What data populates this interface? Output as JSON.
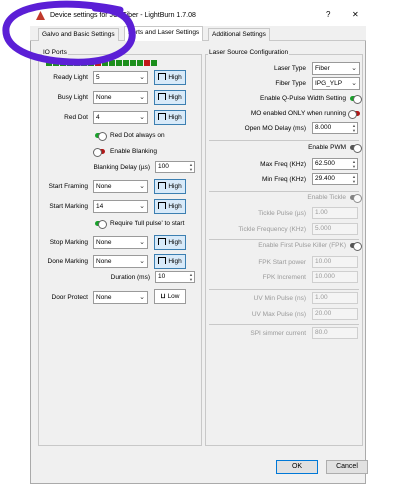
{
  "window": {
    "title": "Device settings for JCZFiber - LightBurn 1.7.08",
    "help_glyph": "?",
    "close_glyph": "✕"
  },
  "tabs": [
    {
      "label": "Galvo and Basic Settings"
    },
    {
      "label": "Ports and Laser Settings"
    },
    {
      "label": "Additional Settings"
    }
  ],
  "io_ports": {
    "group_title": "IO Ports",
    "pins": [
      "on",
      "on",
      "on",
      "on",
      "on",
      "on",
      "on",
      "off",
      "on",
      "on",
      "on",
      "on",
      "on",
      "on",
      "off",
      "on"
    ],
    "ready_light": {
      "label": "Ready Light",
      "value": "5",
      "button": "High"
    },
    "busy_light": {
      "label": "Busy Light",
      "value": "None",
      "button": "High"
    },
    "red_dot": {
      "label": "Red Dot",
      "value": "4",
      "button": "High"
    },
    "red_dot_always_on": {
      "label": "Red Dot always on",
      "checked": true
    },
    "enable_blanking": {
      "label": "Enable Blanking",
      "checked": false
    },
    "blanking_delay": {
      "label": "Blanking Delay (µs)",
      "value": "100"
    },
    "start_framing": {
      "label": "Start Framing",
      "value": "None",
      "button": "High"
    },
    "start_marking": {
      "label": "Start Marking",
      "value": "14",
      "button": "High"
    },
    "require_full_pulse": {
      "label": "Require 'full pulse' to start",
      "checked": true
    },
    "stop_marking": {
      "label": "Stop Marking",
      "value": "None",
      "button": "High"
    },
    "done_marking": {
      "label": "Done Marking",
      "value": "None",
      "button": "High"
    },
    "duration": {
      "label": "Duration (ms)",
      "value": "10"
    },
    "door_protect": {
      "label": "Door Protect",
      "value": "None",
      "button": "Low"
    }
  },
  "laser_source": {
    "group_title": "Laser Source Configuration",
    "laser_type": {
      "label": "Laser Type",
      "value": "Fiber"
    },
    "fiber_type": {
      "label": "Fiber Type",
      "value": "IPG_YLP"
    },
    "enable_qpulse": {
      "label": "Enable Q-Pulse Width Setting",
      "on": true
    },
    "mo_enabled": {
      "label": "MO enabled ONLY when running",
      "on": false
    },
    "open_mo_delay": {
      "label": "Open MO Delay (ms)",
      "value": "8.000"
    },
    "enable_pwm": {
      "label": "Enable PWM"
    },
    "max_freq": {
      "label": "Max Freq (KHz)",
      "value": "62.500"
    },
    "min_freq": {
      "label": "Min Freq (KHz)",
      "value": "29.400"
    },
    "enable_tickle": {
      "label": "Enable Tickle"
    },
    "tickle_pulse": {
      "label": "Tickle Pulse (µs)",
      "value": "1.00"
    },
    "tickle_freq": {
      "label": "Tickle Frequency (KHz)",
      "value": "5.000"
    },
    "enable_fpk": {
      "label": "Enable First Pulse Killer (FPK)"
    },
    "fpk_start": {
      "label": "FPK Start power",
      "value": "10.00"
    },
    "fpk_increment": {
      "label": "FPK Increment",
      "value": "10.000"
    },
    "uv_min_pulse": {
      "label": "UV Min Pulse (ns)",
      "value": "1.00"
    },
    "uv_max_pulse": {
      "label": "UV Max Pulse (ns)",
      "value": "20.00"
    },
    "spi_simmer": {
      "label": "SPI simmer current",
      "value": "80.0"
    }
  },
  "footer": {
    "ok": "OK",
    "cancel": "Cancel"
  },
  "colors": {
    "accent_button": "#d8eaf9",
    "toggle_on": "#1aa02b",
    "toggle_off": "#b01818",
    "annotation": "#5b1fd6"
  }
}
